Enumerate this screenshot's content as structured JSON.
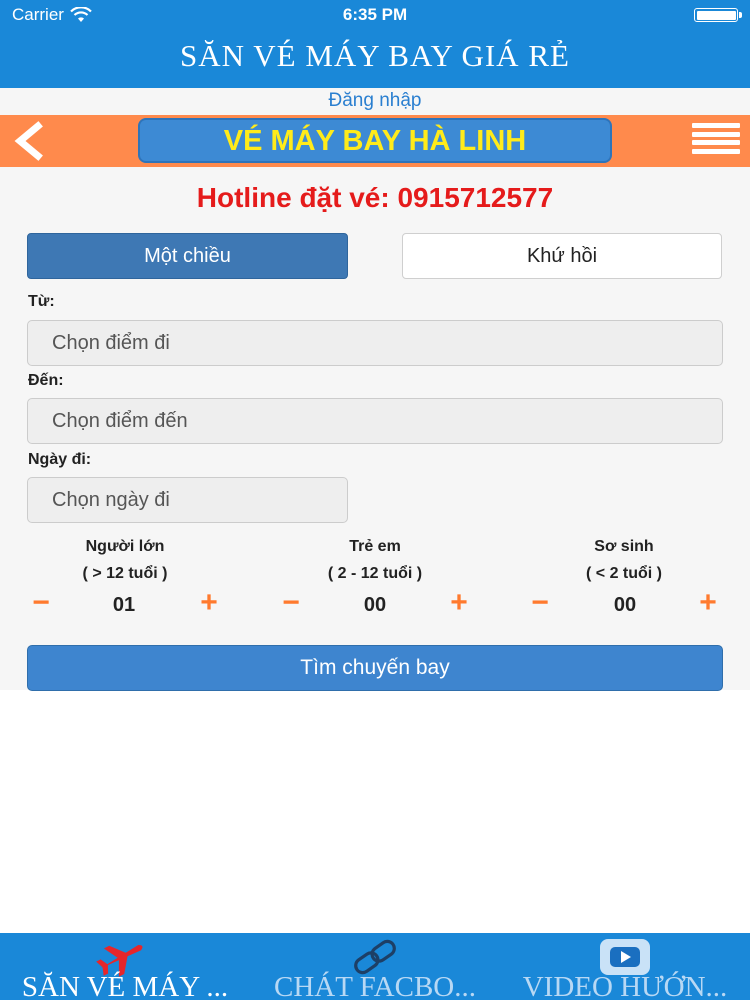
{
  "status_bar": {
    "carrier": "Carrier",
    "time": "6:35 PM"
  },
  "app_title": "SĂN VÉ MÁY BAY GIÁ RẺ",
  "login_link": "Đăng nhập",
  "brand": {
    "title": "VÉ MÁY BAY HÀ LINH"
  },
  "hotline": "Hotline đặt vé: 0915712577",
  "trip_type": {
    "one_way": "Một chiều",
    "round_trip": "Khứ hồi",
    "selected": "one_way"
  },
  "form": {
    "from_label": "Từ:",
    "from_placeholder": "Chọn điểm đi",
    "to_label": "Đến:",
    "to_placeholder": "Chọn điểm đến",
    "date_label": "Ngày đi:",
    "date_placeholder": "Chọn ngày đi"
  },
  "passengers": [
    {
      "label": "Người lớn",
      "age": "( > 12 tuổi )",
      "value": "01"
    },
    {
      "label": "Trẻ em",
      "age": "( 2 - 12 tuổi )",
      "value": "00"
    },
    {
      "label": "Sơ sinh",
      "age": "( < 2 tuổi )",
      "value": "00"
    }
  ],
  "pax_controls": {
    "minus": "−",
    "plus": "+"
  },
  "search_button": "Tìm chuyến bay",
  "bottom_tabs": [
    {
      "label": "SĂN VÉ MÁY ...",
      "icon": "airplane-icon"
    },
    {
      "label": "CHÁT FACBO...",
      "icon": "link-icon"
    },
    {
      "label": "VIDEO HƯỚN...",
      "icon": "video-icon"
    }
  ],
  "colors": {
    "header_blue": "#1a88d8",
    "orange_bar": "#ff8a4c",
    "brand_text": "#ffeb1a",
    "hotline_red": "#e51b1b",
    "plus_minus_orange": "#ff7a2e",
    "airplane_red": "#e6262b"
  }
}
